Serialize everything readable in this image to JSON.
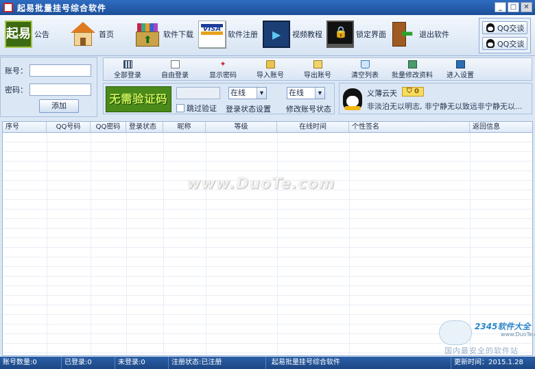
{
  "window": {
    "title": "起易批量挂号综合软件"
  },
  "toolbar": {
    "logo_text": "起易",
    "items": [
      {
        "label": "公告",
        "icon": "logo-icon"
      },
      {
        "label": "首页",
        "icon": "house-icon"
      },
      {
        "label": "软件下载",
        "icon": "download-box-icon"
      },
      {
        "label": "软件注册",
        "icon": "visa-card-icon"
      },
      {
        "label": "视频教程",
        "icon": "film-icon"
      },
      {
        "label": "锁定界面",
        "icon": "lock-screen-icon"
      },
      {
        "label": "退出软件",
        "icon": "exit-door-icon"
      }
    ],
    "visa_text": "VISA",
    "qq_buttons": [
      "QQ交谈",
      "QQ交谈"
    ]
  },
  "account": {
    "account_label": "账号：",
    "password_label": "密码：",
    "account_value": "",
    "password_value": "",
    "add_button": "添加"
  },
  "actions": [
    {
      "label": "全部登录",
      "icon": "grid-icon"
    },
    {
      "label": "自由登录",
      "icon": "paper-icon"
    },
    {
      "label": "显示密码",
      "icon": "star-icon"
    },
    {
      "label": "导入账号",
      "icon": "folder-icon"
    },
    {
      "label": "导出账号",
      "icon": "folder-open-icon"
    },
    {
      "label": "清空列表",
      "icon": "basket-icon"
    },
    {
      "label": "批量修改资料",
      "icon": "disk-icon"
    },
    {
      "label": "进入设置",
      "icon": "monitor-icon"
    }
  ],
  "captcha": {
    "image_text": "无需验证码",
    "skip_label": "跳过验证",
    "login_status_value": "在线",
    "login_status_label": "登录状态设置",
    "modify_status_value": "在线",
    "modify_status_label": "修改账号状态"
  },
  "profile": {
    "name": "义薄云天",
    "vip_level": "0",
    "signature": "非淡泊无以明志, 非宁静无以致远非宁静无以..."
  },
  "table": {
    "columns": [
      "序号",
      "QQ号码",
      "QQ密码",
      "登录状态",
      "昵称",
      "等级",
      "在线时间",
      "个性签名",
      "返回信息"
    ],
    "rows": []
  },
  "watermark": "www.DuoTe.com",
  "badge": {
    "brand": "2345软件大全",
    "site": "www.DuoTe.com",
    "slogan": "国内最安全的软件站"
  },
  "status": {
    "count": "账号数量:0",
    "logged_in": "已登录:0",
    "not_logged_in": "未登录:0",
    "registration": "注册状态:已注册",
    "app_name": "起易批量挂号综合软件",
    "update_time": "更新时间：2015.1.28"
  }
}
